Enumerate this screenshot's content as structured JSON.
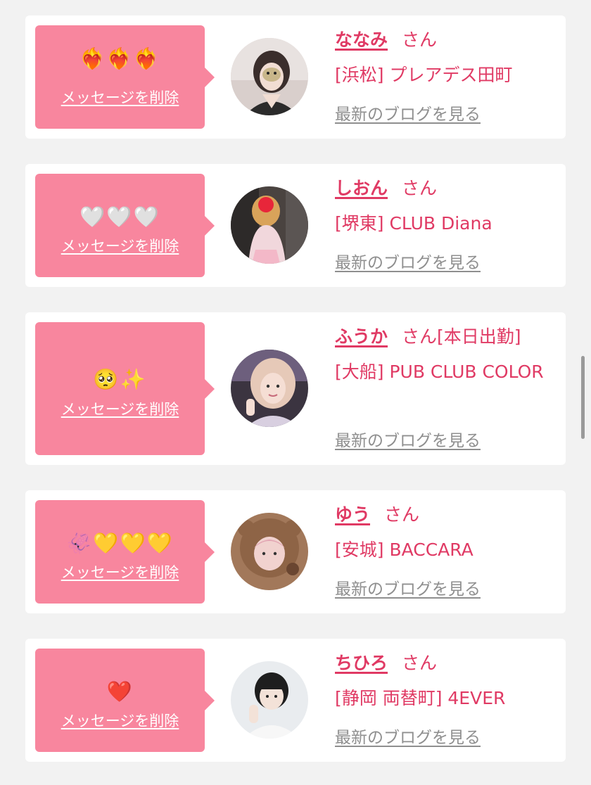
{
  "delete_label": "メッセージを削除",
  "honorific": "さん",
  "blog_label": "最新のブログを見る",
  "colors": {
    "background": "#f2f2f2",
    "card": "#ffffff",
    "bubble": "#f8869e",
    "accent": "#e03a64",
    "link_gray": "#8f8f8f"
  },
  "messages": [
    {
      "emojis": "❤️‍🔥❤️‍🔥❤️‍🔥",
      "name": "ななみ",
      "status": "",
      "shop": "[浜松] プレアデス田町",
      "avatar_icon": "girl-photo-avatar"
    },
    {
      "emojis": "🤍🤍🤍",
      "name": "しおん",
      "status": "",
      "shop": "[堺東] CLUB Diana",
      "avatar_icon": "girl-photo-avatar"
    },
    {
      "emojis": "🥺✨",
      "name": "ふうか",
      "status": "[本日出勤]",
      "shop": "[大船] PUB CLUB COLOR",
      "avatar_icon": "girl-photo-avatar"
    },
    {
      "emojis": "🦑💛💛💛",
      "name": "ゆう",
      "status": "",
      "shop": "[安城] BACCARA",
      "avatar_icon": "girl-photo-avatar"
    },
    {
      "emojis": "❤️",
      "name": "ちひろ",
      "status": "",
      "shop": "[静岡 両替町] 4EVER",
      "avatar_icon": "girl-photo-avatar"
    }
  ]
}
